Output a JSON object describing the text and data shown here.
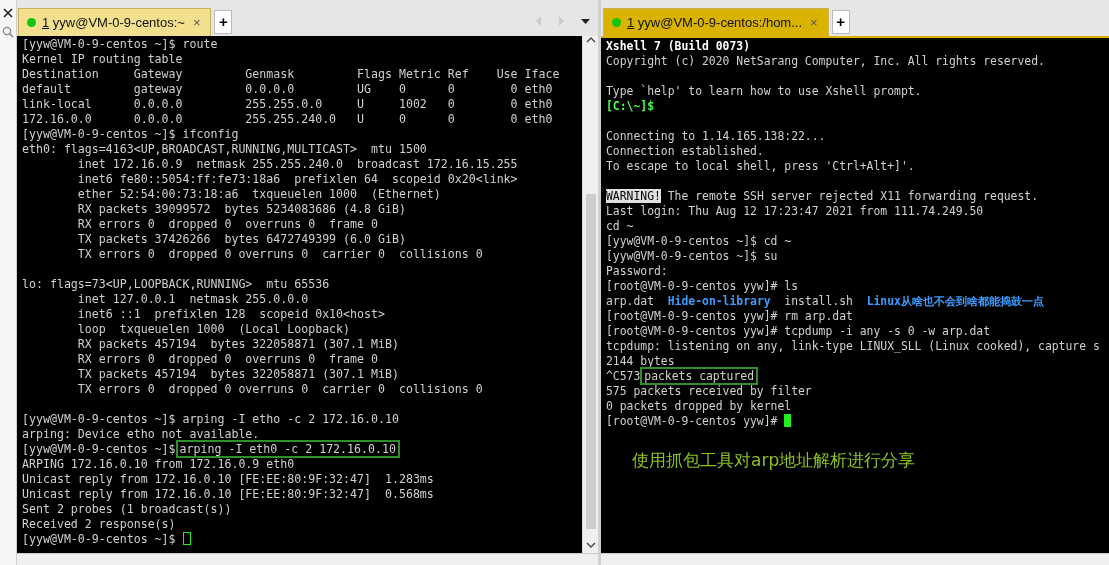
{
  "panes": [
    {
      "focused": false,
      "tab": {
        "number": "1",
        "label": " yyw@VM-0-9-centos:~",
        "close": "×"
      },
      "new_tab": "+",
      "side_strip": true,
      "scrollbar": true,
      "lines": [
        {
          "segments": [
            {
              "kind": "plain",
              "text": "[yyw@VM-0-9-centos ~]$ route"
            }
          ]
        },
        {
          "segments": [
            {
              "kind": "plain",
              "text": "Kernel IP routing table"
            }
          ]
        },
        {
          "segments": [
            {
              "kind": "plain",
              "text": "Destination     Gateway         Genmask         Flags Metric Ref    Use Iface"
            }
          ]
        },
        {
          "segments": [
            {
              "kind": "plain",
              "text": "default         gateway         0.0.0.0         UG    0      0        0 eth0"
            }
          ]
        },
        {
          "segments": [
            {
              "kind": "plain",
              "text": "link-local      0.0.0.0         255.255.0.0     U     1002   0        0 eth0"
            }
          ]
        },
        {
          "segments": [
            {
              "kind": "plain",
              "text": "172.16.0.0      0.0.0.0         255.255.240.0   U     0      0        0 eth0"
            }
          ]
        },
        {
          "segments": [
            {
              "kind": "plain",
              "text": "[yyw@VM-0-9-centos ~]$ ifconfig"
            }
          ]
        },
        {
          "segments": [
            {
              "kind": "plain",
              "text": "eth0: flags=4163<UP,BROADCAST,RUNNING,MULTICAST>  mtu 1500"
            }
          ]
        },
        {
          "segments": [
            {
              "kind": "plain",
              "text": "        inet 172.16.0.9  netmask 255.255.240.0  broadcast 172.16.15.255"
            }
          ]
        },
        {
          "segments": [
            {
              "kind": "plain",
              "text": "        inet6 fe80::5054:ff:fe73:18a6  prefixlen 64  scopeid 0x20<link>"
            }
          ]
        },
        {
          "segments": [
            {
              "kind": "plain",
              "text": "        ether 52:54:00:73:18:a6  txqueuelen 1000  (Ethernet)"
            }
          ]
        },
        {
          "segments": [
            {
              "kind": "plain",
              "text": "        RX packets 39099572  bytes 5234083686 (4.8 GiB)"
            }
          ]
        },
        {
          "segments": [
            {
              "kind": "plain",
              "text": "        RX errors 0  dropped 0  overruns 0  frame 0"
            }
          ]
        },
        {
          "segments": [
            {
              "kind": "plain",
              "text": "        TX packets 37426266  bytes 6472749399 (6.0 GiB)"
            }
          ]
        },
        {
          "segments": [
            {
              "kind": "plain",
              "text": "        TX errors 0  dropped 0 overruns 0  carrier 0  collisions 0"
            }
          ]
        },
        {
          "blank": true
        },
        {
          "segments": [
            {
              "kind": "plain",
              "text": "lo: flags=73<UP,LOOPBACK,RUNNING>  mtu 65536"
            }
          ]
        },
        {
          "segments": [
            {
              "kind": "plain",
              "text": "        inet 127.0.0.1  netmask 255.0.0.0"
            }
          ]
        },
        {
          "segments": [
            {
              "kind": "plain",
              "text": "        inet6 ::1  prefixlen 128  scopeid 0x10<host>"
            }
          ]
        },
        {
          "segments": [
            {
              "kind": "plain",
              "text": "        loop  txqueuelen 1000  (Local Loopback)"
            }
          ]
        },
        {
          "segments": [
            {
              "kind": "plain",
              "text": "        RX packets 457194  bytes 322058871 (307.1 MiB)"
            }
          ]
        },
        {
          "segments": [
            {
              "kind": "plain",
              "text": "        RX errors 0  dropped 0  overruns 0  frame 0"
            }
          ]
        },
        {
          "segments": [
            {
              "kind": "plain",
              "text": "        TX packets 457194  bytes 322058871 (307.1 MiB)"
            }
          ]
        },
        {
          "segments": [
            {
              "kind": "plain",
              "text": "        TX errors 0  dropped 0 overruns 0  carrier 0  collisions 0"
            }
          ]
        },
        {
          "blank": true
        },
        {
          "segments": [
            {
              "kind": "plain",
              "text": "[yyw@VM-0-9-centos ~]$ arping -I etho -c 2 172.16.0.10"
            }
          ]
        },
        {
          "segments": [
            {
              "kind": "plain",
              "text": "arping: Device etho not available."
            }
          ]
        },
        {
          "segments": [
            {
              "kind": "plain",
              "text": "[yyw@VM-0-9-centos ~]$"
            },
            {
              "kind": "boxed",
              "text": "arping -I eth0 -c 2 172.16.0.10"
            }
          ]
        },
        {
          "segments": [
            {
              "kind": "plain",
              "text": "ARPING 172.16.0.10 from 172.16.0.9 eth0"
            }
          ]
        },
        {
          "segments": [
            {
              "kind": "plain",
              "text": "Unicast reply from 172.16.0.10 [FE:EE:80:9F:32:47]  1.283ms"
            }
          ]
        },
        {
          "segments": [
            {
              "kind": "plain",
              "text": "Unicast reply from 172.16.0.10 [FE:EE:80:9F:32:47]  0.568ms"
            }
          ]
        },
        {
          "segments": [
            {
              "kind": "plain",
              "text": "Sent 2 probes (1 broadcast(s))"
            }
          ]
        },
        {
          "segments": [
            {
              "kind": "plain",
              "text": "Received 2 response(s)"
            }
          ]
        },
        {
          "segments": [
            {
              "kind": "plain",
              "text": "[yyw@VM-0-9-centos ~]$ "
            },
            {
              "kind": "cursor_outline"
            }
          ]
        }
      ]
    },
    {
      "focused": true,
      "tab": {
        "number": "1",
        "label": " yyw@VM-0-9-centos:/hom...",
        "close": "×"
      },
      "new_tab": "+",
      "lines": [
        {
          "segments": [
            {
              "kind": "bold",
              "text": "Xshell 7 (Build 0073)"
            }
          ]
        },
        {
          "segments": [
            {
              "kind": "plain",
              "text": "Copyright (c) 2020 NetSarang Computer, Inc. All rights reserved."
            }
          ]
        },
        {
          "blank": true
        },
        {
          "segments": [
            {
              "kind": "plain",
              "text": "Type `help' to learn how to use Xshell prompt."
            }
          ]
        },
        {
          "segments": [
            {
              "kind": "prompt",
              "text": "[C:\\~]$"
            }
          ]
        },
        {
          "blank": true
        },
        {
          "segments": [
            {
              "kind": "plain",
              "text": "Connecting to 1.14.165.138:22..."
            }
          ]
        },
        {
          "segments": [
            {
              "kind": "plain",
              "text": "Connection established."
            }
          ]
        },
        {
          "segments": [
            {
              "kind": "plain",
              "text": "To escape to local shell, press 'Ctrl+Alt+]'."
            }
          ]
        },
        {
          "blank": true
        },
        {
          "segments": [
            {
              "kind": "inverse",
              "text": "WARNING!"
            },
            {
              "kind": "plain",
              "text": " The remote SSH server rejected X11 forwarding request."
            }
          ]
        },
        {
          "segments": [
            {
              "kind": "plain",
              "text": "Last login: Thu Aug 12 17:23:47 2021 from 111.74.249.50"
            }
          ]
        },
        {
          "segments": [
            {
              "kind": "plain",
              "text": "cd ~"
            }
          ]
        },
        {
          "segments": [
            {
              "kind": "plain",
              "text": "[yyw@VM-0-9-centos ~]$ cd ~"
            }
          ]
        },
        {
          "segments": [
            {
              "kind": "plain",
              "text": "[yyw@VM-0-9-centos ~]$ su"
            }
          ]
        },
        {
          "segments": [
            {
              "kind": "plain",
              "text": "Password:"
            }
          ]
        },
        {
          "segments": [
            {
              "kind": "plain",
              "text": "[root@VM-0-9-centos yyw]# ls"
            }
          ]
        },
        {
          "segments": [
            {
              "kind": "plain",
              "text": "arp.dat  "
            },
            {
              "kind": "dir",
              "text": "Hide-on-library"
            },
            {
              "kind": "plain",
              "text": "  install.sh  "
            },
            {
              "kind": "dir",
              "text": "Linux从啥也不会到啥都能捣鼓一点"
            }
          ]
        },
        {
          "segments": [
            {
              "kind": "plain",
              "text": "[root@VM-0-9-centos yyw]# rm arp.dat"
            }
          ]
        },
        {
          "segments": [
            {
              "kind": "plain",
              "text": "[root@VM-0-9-centos yyw]# tcpdump -i any -s 0 -w arp.dat"
            }
          ]
        },
        {
          "segments": [
            {
              "kind": "plain",
              "text": "tcpdump: listening on any, link-type LINUX_SLL (Linux cooked), capture s"
            }
          ]
        },
        {
          "segments": [
            {
              "kind": "plain",
              "text": "2144 bytes"
            }
          ]
        },
        {
          "segments": [
            {
              "kind": "plain",
              "text": "^C573"
            },
            {
              "kind": "boxed",
              "text": "packets captured"
            }
          ]
        },
        {
          "segments": [
            {
              "kind": "plain",
              "text": "575 packets received by filter"
            }
          ]
        },
        {
          "segments": [
            {
              "kind": "plain",
              "text": "0 packets dropped by kernel"
            }
          ]
        },
        {
          "segments": [
            {
              "kind": "plain",
              "text": "[root@VM-0-9-centos yyw]# "
            },
            {
              "kind": "cursor_block"
            }
          ]
        }
      ],
      "annotation": "使用抓包工具对arp地址解析进行分享"
    }
  ]
}
